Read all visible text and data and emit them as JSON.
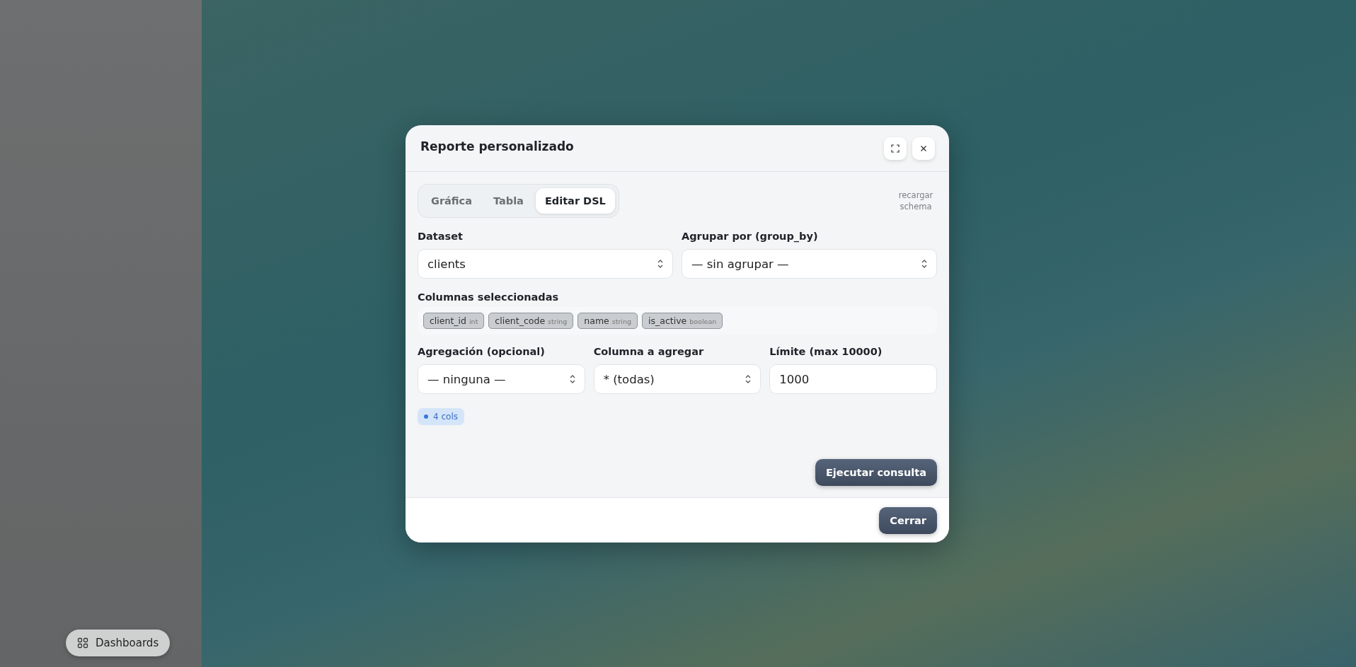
{
  "modal": {
    "title": "Reporte personalizado",
    "tabs": [
      {
        "label": "Gráfica",
        "selected": false
      },
      {
        "label": "Tabla",
        "selected": false
      },
      {
        "label": "Editar DSL",
        "selected": true
      }
    ],
    "reload_link": "recargar schema",
    "dataset": {
      "label": "Dataset",
      "value": "clients"
    },
    "group_by": {
      "label": "Agrupar por (group_by)",
      "value": "— sin agrupar —"
    },
    "selected_columns": {
      "label": "Columnas seleccionadas",
      "chips": [
        {
          "name": "client_id",
          "type": "int"
        },
        {
          "name": "client_code",
          "type": "string"
        },
        {
          "name": "name",
          "type": "string"
        },
        {
          "name": "is_active",
          "type": "boolean"
        }
      ]
    },
    "aggregation": {
      "label": "Agregación (opcional)",
      "value": "— ninguna —"
    },
    "aggregate_column": {
      "label": "Columna a agregar",
      "value": "* (todas)"
    },
    "limit": {
      "label": "Límite (max 10000)",
      "value": "1000"
    },
    "count_badge": "4 cols",
    "run_button": "Ejecutar consulta",
    "close_button": "Cerrar"
  },
  "dashboards_button": "Dashboards"
}
